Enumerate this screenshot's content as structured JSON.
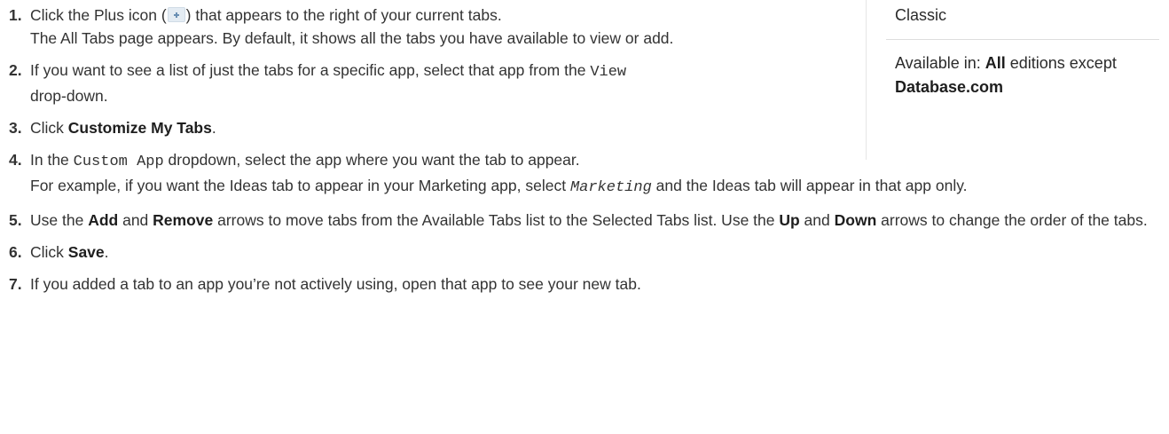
{
  "steps": [
    {
      "num": "1.",
      "text_before_icon": "Click the Plus icon (",
      "text_after_icon": ") that appears to the right of your current tabs.",
      "sub": "The All Tabs page appears. By default, it shows all the tabs you have available to view or add."
    },
    {
      "num": "2.",
      "text_before": "If you want to see a list of just the tabs for a specific app, select that app from the ",
      "code": "View",
      "text_after": " drop-down."
    },
    {
      "num": "3.",
      "text_before": "Click ",
      "bold": "Customize My Tabs",
      "text_after": "."
    },
    {
      "num": "4.",
      "text_before": "In the ",
      "code": "Custom App",
      "text_after": " dropdown, select the app where you want the tab to appear.",
      "sub_before": "For example, if you want the Ideas tab to appear in your Marketing app, select ",
      "sub_code": "Marketing",
      "sub_after": " and the Ideas tab will appear in that app only."
    },
    {
      "num": "5.",
      "t1": "Use the ",
      "b1": "Add",
      "t2": " and ",
      "b2": "Remove",
      "t3": " arrows to move tabs from the Available Tabs list to the Selected Tabs list. Use the ",
      "b3": "Up",
      "t4": " and ",
      "b4": "Down",
      "t5": " arrows to change the order of the tabs."
    },
    {
      "num": "6.",
      "text_before": "Click ",
      "bold": "Save",
      "text_after": "."
    },
    {
      "num": "7.",
      "text": "If you added a tab to an app you’re not actively using, open that app to see your new tab."
    }
  ],
  "sidebar": {
    "title": "Classic",
    "avail_prefix": "Available in: ",
    "avail_bold1": "All",
    "avail_mid": " editions except ",
    "avail_bold2": "Database.com"
  },
  "icons": {
    "plus": "plus-icon"
  }
}
